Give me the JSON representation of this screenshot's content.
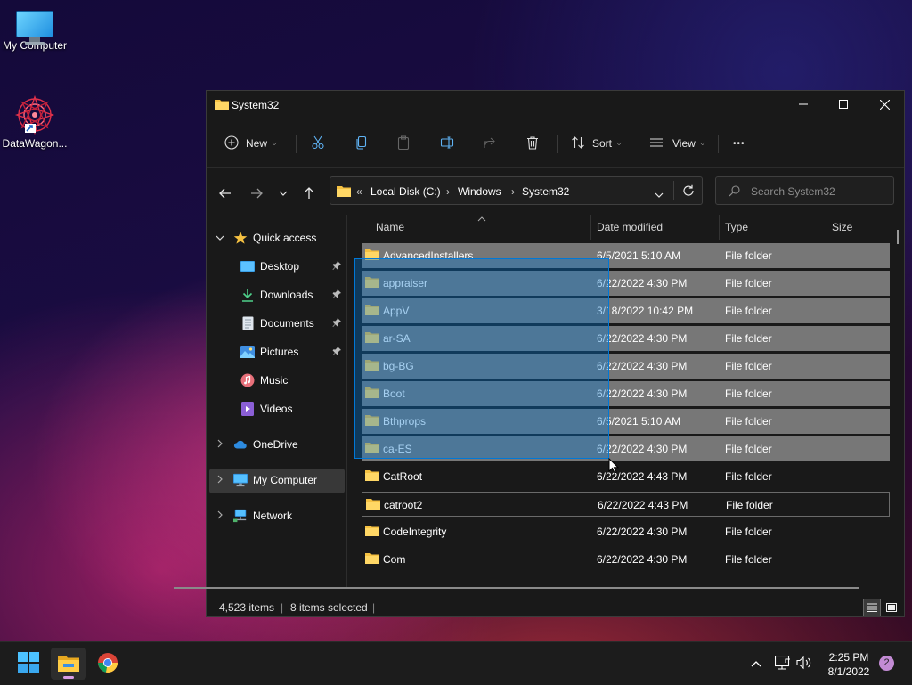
{
  "desktop": {
    "icons": [
      {
        "label": "My Computer"
      },
      {
        "label": "DataWagon..."
      }
    ]
  },
  "window": {
    "title": "System32",
    "toolbar": {
      "new_label": "New",
      "sort_label": "Sort",
      "view_label": "View",
      "more_label": "•••"
    },
    "address": {
      "overflow": "«",
      "crumbs": [
        "Local Disk (C:)",
        "Windows",
        "System32"
      ],
      "separator": "›"
    },
    "search": {
      "placeholder": "Search System32"
    },
    "nav": {
      "quick_access": "Quick access",
      "desktop": "Desktop",
      "downloads": "Downloads",
      "documents": "Documents",
      "pictures": "Pictures",
      "music": "Music",
      "videos": "Videos",
      "onedrive": "OneDrive",
      "my_computer": "My Computer",
      "network": "Network"
    },
    "columns": {
      "name": "Name",
      "date": "Date modified",
      "type": "Type",
      "size": "Size"
    },
    "files": [
      {
        "name": "AdvancedInstallers",
        "date": "6/5/2021 5:10 AM",
        "type": "File folder"
      },
      {
        "name": "appraiser",
        "date": "6/22/2022 4:30 PM",
        "type": "File folder"
      },
      {
        "name": "AppV",
        "date": "3/18/2022 10:42 PM",
        "type": "File folder"
      },
      {
        "name": "ar-SA",
        "date": "6/22/2022 4:30 PM",
        "type": "File folder"
      },
      {
        "name": "bg-BG",
        "date": "6/22/2022 4:30 PM",
        "type": "File folder"
      },
      {
        "name": "Boot",
        "date": "6/22/2022 4:30 PM",
        "type": "File folder"
      },
      {
        "name": "Bthprops",
        "date": "6/5/2021 5:10 AM",
        "type": "File folder"
      },
      {
        "name": "ca-ES",
        "date": "6/22/2022 4:30 PM",
        "type": "File folder"
      },
      {
        "name": "CatRoot",
        "date": "6/22/2022 4:43 PM",
        "type": "File folder"
      },
      {
        "name": "catroot2",
        "date": "6/22/2022 4:43 PM",
        "type": "File folder"
      },
      {
        "name": "CodeIntegrity",
        "date": "6/22/2022 4:30 PM",
        "type": "File folder"
      },
      {
        "name": "Com",
        "date": "6/22/2022 4:30 PM",
        "type": "File folder"
      }
    ],
    "status": {
      "items": "4,523 items",
      "selected": "8 items selected"
    }
  },
  "taskbar": {
    "time": "2:25 PM",
    "date": "8/1/2022",
    "notifications": "2"
  },
  "colors": {
    "folder": "#f5c142",
    "accent": "#0078d7",
    "selection": "#777777"
  }
}
